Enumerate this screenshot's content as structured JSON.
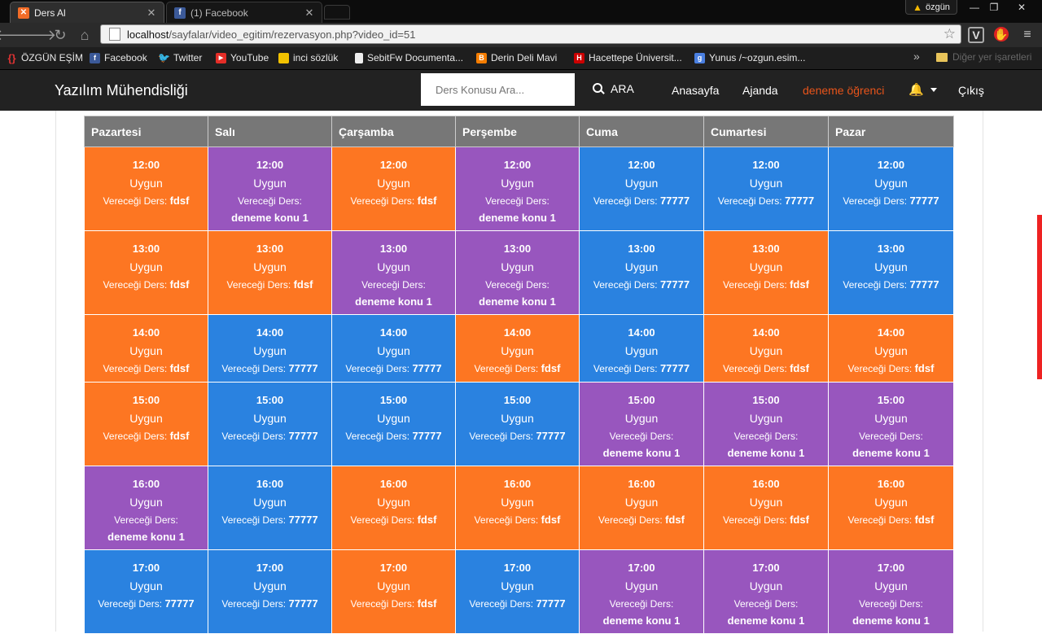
{
  "browser": {
    "tabs": [
      {
        "title": "Ders Al",
        "active": true
      },
      {
        "title": "(1) Facebook",
        "active": false
      }
    ],
    "profile": "özgün",
    "url_host": "localhost",
    "url_path": "/sayfalar/video_egitim/rezervasyon.php?video_id=51",
    "bookmarks": [
      {
        "label": "ÖZGÜN EŞİM",
        "icon": "braces-icon",
        "color": "#d33"
      },
      {
        "label": "Facebook",
        "icon": "facebook-icon",
        "color": "#3b5998"
      },
      {
        "label": "Twitter",
        "icon": "twitter-icon",
        "color": "#1da1f2"
      },
      {
        "label": "YouTube",
        "icon": "youtube-icon",
        "color": "#e52d27"
      },
      {
        "label": "inci sözlük",
        "icon": "inci-icon",
        "color": "#f2c200"
      },
      {
        "label": "SebitFw Documenta...",
        "icon": "page-icon",
        "color": "#ddd"
      },
      {
        "label": "Derin Deli Mavi",
        "icon": "blogger-icon",
        "color": "#f57d00"
      },
      {
        "label": "Hacettepe Üniversit...",
        "icon": "hacettepe-icon",
        "color": "#c00"
      },
      {
        "label": "Yunus /~ozgun.esim...",
        "icon": "google-icon",
        "color": "#4a7fe0"
      }
    ],
    "other_bookmarks": "Diğer yer işaretleri"
  },
  "site": {
    "brand": "Yazılım Mühendisliği",
    "search_placeholder": "Ders Konusu Ara...",
    "search_button": "ARA",
    "nav": {
      "home": "Anasayfa",
      "agenda": "Ajanda",
      "user": "deneme öğrenci",
      "logout": "Çıkış"
    }
  },
  "colors": {
    "orange": "#fd7622",
    "purple": "#9856be",
    "blue": "#2a82e0",
    "header": "#777777",
    "accent": "#e8541a"
  },
  "schedule": {
    "days": [
      "Pazartesi",
      "Salı",
      "Çarşamba",
      "Perşembe",
      "Cuma",
      "Cumartesi",
      "Pazar"
    ],
    "status": "Uygun",
    "label": "Vereceği Ders:",
    "rows": [
      {
        "time": "12:00",
        "cells": [
          {
            "color": "orange",
            "topic": "fdsf"
          },
          {
            "color": "purple",
            "topic": "deneme konu 1"
          },
          {
            "color": "orange",
            "topic": "fdsf"
          },
          {
            "color": "purple",
            "topic": "deneme konu 1"
          },
          {
            "color": "blue",
            "topic": "77777"
          },
          {
            "color": "blue",
            "topic": "77777"
          },
          {
            "color": "blue",
            "topic": "77777"
          }
        ]
      },
      {
        "time": "13:00",
        "cells": [
          {
            "color": "orange",
            "topic": "fdsf"
          },
          {
            "color": "orange",
            "topic": "fdsf"
          },
          {
            "color": "purple",
            "topic": "deneme konu 1"
          },
          {
            "color": "purple",
            "topic": "deneme konu 1"
          },
          {
            "color": "blue",
            "topic": "77777"
          },
          {
            "color": "orange",
            "topic": "fdsf"
          },
          {
            "color": "blue",
            "topic": "77777"
          }
        ]
      },
      {
        "time": "14:00",
        "cells": [
          {
            "color": "orange",
            "topic": "fdsf"
          },
          {
            "color": "blue",
            "topic": "77777"
          },
          {
            "color": "blue",
            "topic": "77777"
          },
          {
            "color": "orange",
            "topic": "fdsf"
          },
          {
            "color": "blue",
            "topic": "77777"
          },
          {
            "color": "orange",
            "topic": "fdsf"
          },
          {
            "color": "orange",
            "topic": "fdsf"
          }
        ]
      },
      {
        "time": "15:00",
        "cells": [
          {
            "color": "orange",
            "topic": "fdsf"
          },
          {
            "color": "blue",
            "topic": "77777"
          },
          {
            "color": "blue",
            "topic": "77777"
          },
          {
            "color": "blue",
            "topic": "77777"
          },
          {
            "color": "purple",
            "topic": "deneme konu 1"
          },
          {
            "color": "purple",
            "topic": "deneme konu 1"
          },
          {
            "color": "purple",
            "topic": "deneme konu 1"
          }
        ]
      },
      {
        "time": "16:00",
        "cells": [
          {
            "color": "purple",
            "topic": "deneme konu 1"
          },
          {
            "color": "blue",
            "topic": "77777"
          },
          {
            "color": "orange",
            "topic": "fdsf"
          },
          {
            "color": "orange",
            "topic": "fdsf"
          },
          {
            "color": "orange",
            "topic": "fdsf"
          },
          {
            "color": "orange",
            "topic": "fdsf"
          },
          {
            "color": "orange",
            "topic": "fdsf"
          }
        ]
      },
      {
        "time": "17:00",
        "cells": [
          {
            "color": "blue",
            "topic": "77777"
          },
          {
            "color": "blue",
            "topic": "77777"
          },
          {
            "color": "orange",
            "topic": "fdsf"
          },
          {
            "color": "blue",
            "topic": "77777"
          },
          {
            "color": "purple",
            "topic": "deneme konu 1"
          },
          {
            "color": "purple",
            "topic": "deneme konu 1"
          },
          {
            "color": "purple",
            "topic": "deneme konu 1"
          }
        ]
      }
    ]
  }
}
